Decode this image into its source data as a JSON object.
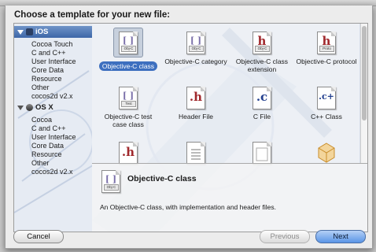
{
  "dialog": {
    "title": "Choose a template for your new file:"
  },
  "sidebar": {
    "sections": [
      {
        "label": "iOS",
        "selected": true,
        "items": [
          "Cocoa Touch",
          "C and C++",
          "User Interface",
          "Core Data",
          "Resource",
          "Other",
          "cocos2d v2.x"
        ]
      },
      {
        "label": "OS X",
        "selected": false,
        "items": [
          "Cocoa",
          "C and C++",
          "User Interface",
          "Core Data",
          "Resource",
          "Other",
          "cocos2d v2.x"
        ]
      }
    ]
  },
  "templates": [
    {
      "label": "Objective-C class",
      "icon": "objc-class-icon",
      "glyph": "",
      "tag": "Obj-C",
      "selected": true
    },
    {
      "label": "Objective-C category",
      "icon": "objc-category-icon",
      "glyph": "",
      "tag": "Obj-C"
    },
    {
      "label": "Objective-C class extension",
      "icon": "objc-extension-icon",
      "glyph": "h",
      "tag": "Obj-C"
    },
    {
      "label": "Objective-C protocol",
      "icon": "objc-protocol-icon",
      "glyph": "h",
      "tag": "Proto"
    },
    {
      "label": "Objective-C test case class",
      "icon": "objc-test-icon",
      "glyph": "",
      "tag": "Test"
    },
    {
      "label": "Header File",
      "icon": "header-file-icon",
      "glyph": ".h",
      "tag": ""
    },
    {
      "label": "C File",
      "icon": "c-file-icon",
      "glyph": ".c",
      "tag": ""
    },
    {
      "label": "C++ Class",
      "icon": "cpp-class-icon",
      "glyph": ".c+",
      "tag": ""
    },
    {
      "label": "",
      "icon": "h-file-icon",
      "glyph": ".h",
      "tag": ""
    },
    {
      "label": "",
      "icon": "list-doc-icon",
      "glyph": "",
      "tag": ""
    },
    {
      "label": "",
      "icon": "blank-doc-icon",
      "glyph": "",
      "tag": ""
    },
    {
      "label": "",
      "icon": "cube-icon",
      "glyph": "",
      "tag": ""
    }
  ],
  "details": {
    "title": "Objective-C class",
    "icon": "objc-class-icon",
    "tag": "Obj-C",
    "description": "An Objective-C class, with implementation and header files."
  },
  "buttons": {
    "cancel": "Cancel",
    "previous": "Previous",
    "next": "Next"
  },
  "colors": {
    "selection": "#3d6fbf",
    "sidebar_selected": "#4a73b3",
    "glyph_red": "#a0282c",
    "glyph_blue": "#23408f"
  }
}
